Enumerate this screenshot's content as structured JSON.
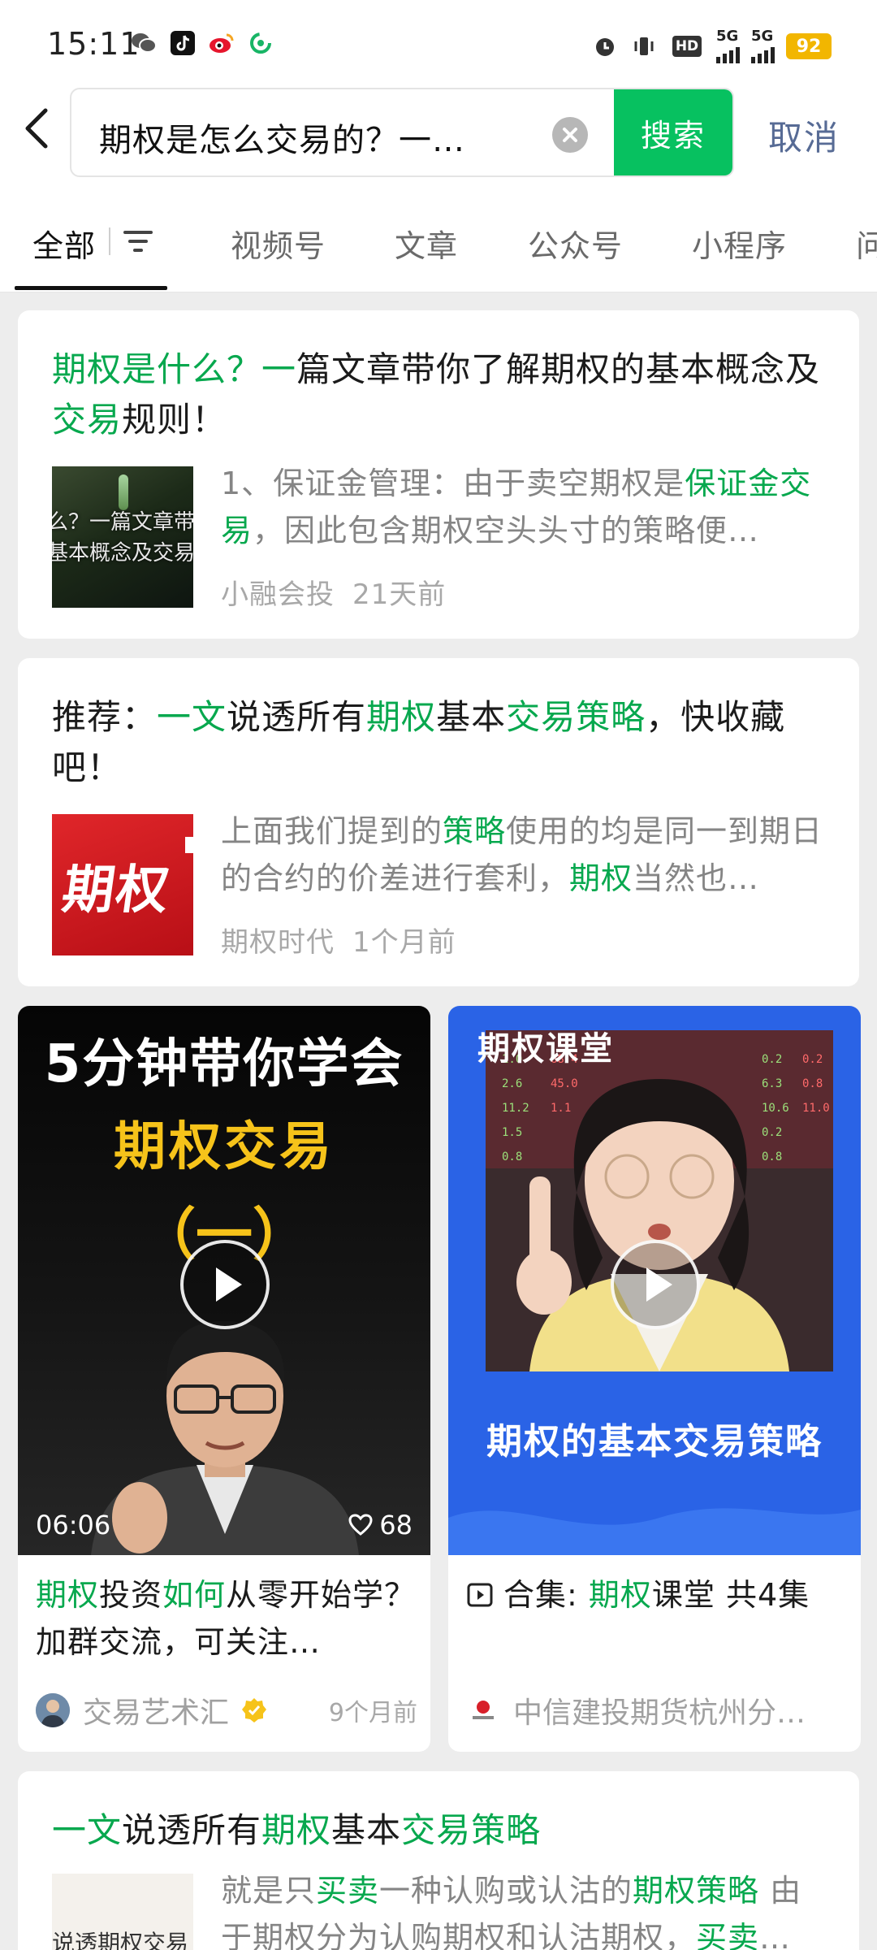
{
  "status_bar": {
    "time": "15:11",
    "battery": "92",
    "network_labels": [
      "5G",
      "5G"
    ],
    "hd_label": "HD",
    "left_icons": [
      "wechat-icon",
      "tiktok-icon",
      "weibo-icon",
      "app-swirl-icon"
    ],
    "right_icons": [
      "alarm-icon",
      "vibrate-icon",
      "hd-icon",
      "signal-icon",
      "signal-icon",
      "battery-icon"
    ]
  },
  "search": {
    "query": "期权是怎么交易的？一…",
    "button_label": "搜索",
    "cancel_label": "取消"
  },
  "tabs": [
    "全部",
    "视频号",
    "文章",
    "公众号",
    "小程序",
    "问"
  ],
  "articles": [
    {
      "title_parts": [
        {
          "text": "期权是什么？一",
          "hl": true
        },
        {
          "text": "篇文章带你了解期权的基本概念及",
          "hl": false
        },
        {
          "text": "交易",
          "hl": true
        },
        {
          "text": "规则！",
          "hl": false
        }
      ],
      "snippet_parts": [
        {
          "text": "1、保证金管理：由于卖空期权是",
          "hl": false
        },
        {
          "text": "保证金交易",
          "hl": true
        },
        {
          "text": "，因此包含期权空头头寸的策略便…",
          "hl": false
        }
      ],
      "thumb_text": [
        "么？一篇文章带",
        "基本概念及交易"
      ],
      "source": "小融会投",
      "time": "21天前"
    },
    {
      "title_parts": [
        {
          "text": "推荐：",
          "hl": false
        },
        {
          "text": "一文",
          "hl": true
        },
        {
          "text": "说透所有",
          "hl": false
        },
        {
          "text": "期权",
          "hl": true
        },
        {
          "text": "基本",
          "hl": false
        },
        {
          "text": "交易策略",
          "hl": true
        },
        {
          "text": "，快收藏吧！",
          "hl": false
        }
      ],
      "snippet_parts": [
        {
          "text": "上面我们提到的",
          "hl": false
        },
        {
          "text": "策略",
          "hl": true
        },
        {
          "text": "使用的均是同一到期日的合约的价差进行套利，",
          "hl": false
        },
        {
          "text": "期权",
          "hl": true
        },
        {
          "text": "当然也…",
          "hl": false
        }
      ],
      "thumb_text": [
        "期权"
      ],
      "source": "期权时代",
      "time": "1个月前"
    },
    {
      "title_parts": [
        {
          "text": "一文",
          "hl": true
        },
        {
          "text": "说透所有",
          "hl": false
        },
        {
          "text": "期权",
          "hl": true
        },
        {
          "text": "基本",
          "hl": false
        },
        {
          "text": "交易策略",
          "hl": true
        }
      ],
      "snippet_parts": [
        {
          "text": "就是只",
          "hl": false
        },
        {
          "text": "买卖",
          "hl": true
        },
        {
          "text": "一种认购或认沽的",
          "hl": false
        },
        {
          "text": "期权策略",
          "hl": true
        },
        {
          "text": " 由于期权分为认购期权和认沽期权，",
          "hl": false
        },
        {
          "text": "买卖",
          "hl": true
        },
        {
          "text": "…",
          "hl": false
        }
      ],
      "thumb_text": [
        "说透期权交易"
      ]
    }
  ],
  "videos": [
    {
      "thumb_lines": [
        "5分钟带你学会",
        "期权交易",
        "（一）"
      ],
      "duration": "06:06",
      "likes": "68",
      "caption_parts": [
        {
          "text": "期权",
          "hl": true
        },
        {
          "text": "投资",
          "hl": false
        },
        {
          "text": "如何",
          "hl": true
        },
        {
          "text": "从零开始学？加群交流，可关注…",
          "hl": false
        }
      ],
      "author": "交易艺术汇",
      "time": "9个月前"
    },
    {
      "thumb_tag": "期权课堂",
      "thumb_bottom": "期权的基本交易策略",
      "caption_prefix": "合集: ",
      "caption_parts": [
        {
          "text": "期权",
          "hl": true
        },
        {
          "text": "课堂 共4集",
          "hl": false
        }
      ],
      "author": "中信建投期货杭州分…"
    }
  ],
  "colors": {
    "accent_green": "#07c160",
    "highlight_green": "#07a84e",
    "link_blue": "#576b95",
    "background": "#ededed"
  }
}
